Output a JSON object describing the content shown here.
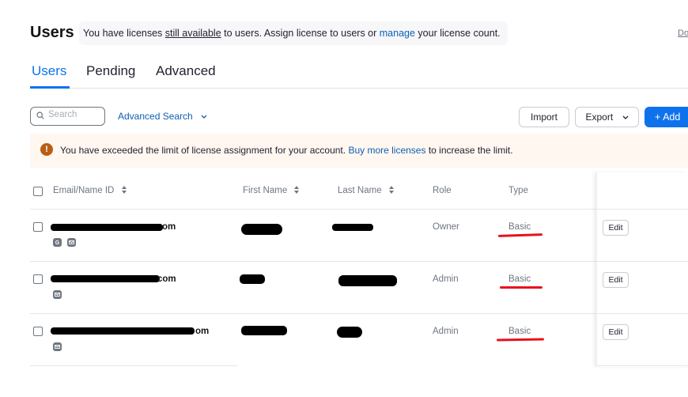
{
  "header": {
    "title": "Users",
    "notice": {
      "part1": "You have licenses ",
      "underlined": "still available",
      "part2": " to users. Assign license to users or ",
      "link": "manage",
      "part3": " your license count."
    },
    "corner_link": "Do"
  },
  "tabs": [
    {
      "label": "Users",
      "active": true
    },
    {
      "label": "Pending",
      "active": false
    },
    {
      "label": "Advanced",
      "active": false
    }
  ],
  "toolbar": {
    "search_placeholder": "Search",
    "advanced_search_label": "Advanced Search",
    "import_label": "Import",
    "export_label": "Export",
    "add_label": "+ Add"
  },
  "banner": {
    "text1": "You have exceeded the limit of license assignment for your account. ",
    "link": "Buy more licenses",
    "text2": " to increase the limit.",
    "icon_text": "!"
  },
  "table": {
    "columns": [
      "Email/Name ID",
      "First Name",
      "Last Name",
      "Role",
      "Type"
    ],
    "rows": [
      {
        "email_suffix": "om",
        "role": "Owner",
        "type": "Basic",
        "edit": "Edit",
        "login_icons": [
          "google-icon",
          "mail-icon"
        ]
      },
      {
        "email_suffix": "com",
        "role": "Admin",
        "type": "Basic",
        "edit": "Edit",
        "login_icons": [
          "mail-icon"
        ]
      },
      {
        "email_suffix": "om",
        "role": "Admin",
        "type": "Basic",
        "edit": "Edit",
        "login_icons": [
          "mail-icon"
        ]
      }
    ]
  },
  "colors": {
    "accent": "#0e72ed",
    "link": "#0e5fb0",
    "warning": "#b95e16",
    "banner_bg": "#fff7f0",
    "annotation_red": "#e8121c"
  }
}
